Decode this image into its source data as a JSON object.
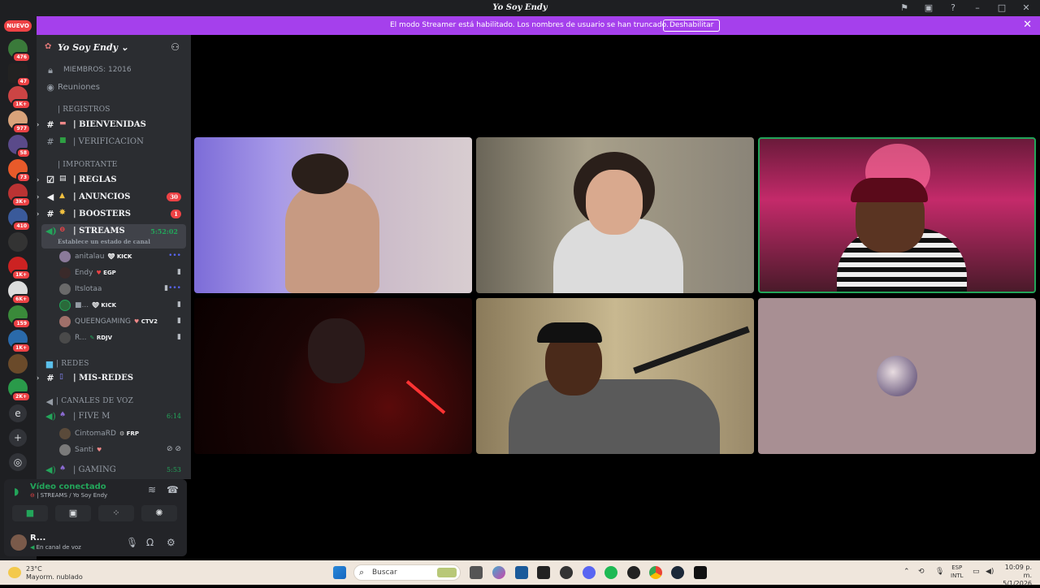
{
  "window": {
    "title": "Yo Soy Endy",
    "icons": [
      "inbox-icon",
      "screen-icon",
      "help-icon",
      "minimize-icon",
      "maximize-icon",
      "close-icon"
    ]
  },
  "banner": {
    "text": "El modo Streamer está habilitado. Los nombres de usuario se han truncado.",
    "button": "Deshabilitar"
  },
  "servers": {
    "nuevo": "NUEVO",
    "badges": [
      "476",
      "47",
      "1K+",
      "977",
      "58",
      "73",
      "3K+",
      "410",
      "1K+",
      "6K+",
      "159",
      "1K+",
      "2K+"
    ],
    "text_server": "e"
  },
  "guild": {
    "name": "Yo Soy Endy",
    "members_label": "MIEMBROS: 12016",
    "reuniones": "Reuniones"
  },
  "channels": {
    "cat_registros": "| REGISTROS",
    "bienvenidas": "| BIENVENIDAS",
    "verificacion": "| VERIFICACION",
    "cat_importante": "| IMPORTANTE",
    "reglas": "| REGLAS",
    "anuncios": "| ANUNCIOS",
    "anuncios_count": "30",
    "boosters": "| BOOSTERS",
    "boosters_count": "1",
    "streams": "| STREAMS",
    "streams_timer": "5:52:02",
    "streams_status": "Establece un estado de canal",
    "cat_redes": "| REDES",
    "mis_redes": "| MIS-REDES",
    "cat_voz": "| CANALES DE VOZ",
    "five_m": "| FIVE M",
    "five_m_timer": "6:14",
    "gaming": "| GAMING",
    "gaming_timer": "5:53"
  },
  "stream_users": [
    {
      "name": "anitalau",
      "tag": "KICK"
    },
    {
      "name": "Endy",
      "tag": "EGP"
    },
    {
      "name": "Itslotaa",
      "tag": ""
    },
    {
      "name": "■...",
      "tag": "KICK"
    },
    {
      "name": "QUEENGAMING",
      "tag": "CTV2"
    },
    {
      "name": "R...",
      "tag": "RDJV"
    }
  ],
  "five_m_users": [
    {
      "name": "CintomaRD",
      "tag": "FRP"
    },
    {
      "name": "Santi",
      "tag": ""
    }
  ],
  "voice_panel": {
    "title": "Vídeo conectado",
    "subtitle": "| STREAMS / Yo Soy Endy"
  },
  "user_panel": {
    "name": "R...",
    "status": "En canal de voz"
  },
  "taskbar": {
    "temp": "23°C",
    "weather": "Mayorm. nublado",
    "search": "Buscar",
    "lang1": "ESP",
    "lang2": "INTL",
    "time": "10:09 p. m.",
    "date": "5/1/2026"
  }
}
